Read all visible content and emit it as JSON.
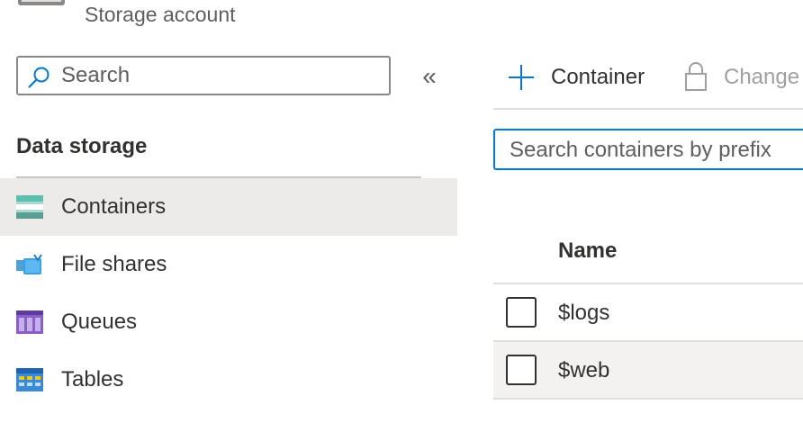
{
  "header": {
    "subtitle": "Storage account"
  },
  "nav": {
    "search_placeholder": "Search",
    "collapse_glyph": "«",
    "section_title": "Data storage",
    "items": [
      {
        "label": "Containers",
        "icon": "containers-icon",
        "selected": true
      },
      {
        "label": "File shares",
        "icon": "file-shares-icon",
        "selected": false
      },
      {
        "label": "Queues",
        "icon": "queues-icon",
        "selected": false
      },
      {
        "label": "Tables",
        "icon": "tables-icon",
        "selected": false
      }
    ]
  },
  "toolbar": {
    "add_label": "Container",
    "change_label": "Change"
  },
  "filter": {
    "placeholder": "Search containers by prefix"
  },
  "table": {
    "columns": [
      "Name"
    ],
    "rows": [
      {
        "name": "$logs"
      },
      {
        "name": "$web"
      }
    ]
  },
  "colors": {
    "accent": "#0078d4",
    "selected_bg": "#edebe9",
    "hover_bg": "#f3f2f1"
  }
}
